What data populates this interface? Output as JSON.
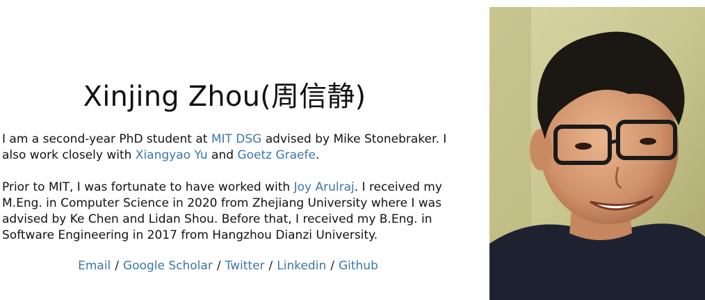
{
  "profile": {
    "name": "Xinjing Zhou(周信静)",
    "intro": {
      "t1": "I am a second-year PhD student at ",
      "link_dsg": "MIT DSG",
      "t2": " advised by Mike Stonebraker. I also work closely with ",
      "link_yu": "Xiangyao Yu",
      "t3": " and ",
      "link_graefe": "Goetz Graefe",
      "t4": "."
    },
    "background": {
      "t1": "Prior to MIT, I was fortunate to have worked with ",
      "link_arulraj": "Joy Arulraj",
      "t2": ". I received my M.Eng. in Computer Science in 2020 from Zhejiang University where I was advised by Ke Chen and Lidan Shou. Before that, I received my B.Eng. in Software Engineering in 2017 from Hangzhou Dianzi University."
    }
  },
  "links": {
    "email": "Email",
    "scholar": "Google Scholar",
    "twitter": "Twitter",
    "linkedin": "Linkedin",
    "github": "Github",
    "separator": "/"
  },
  "colors": {
    "link": "#3a78a8",
    "text": "#111111",
    "background": "#ffffff"
  }
}
